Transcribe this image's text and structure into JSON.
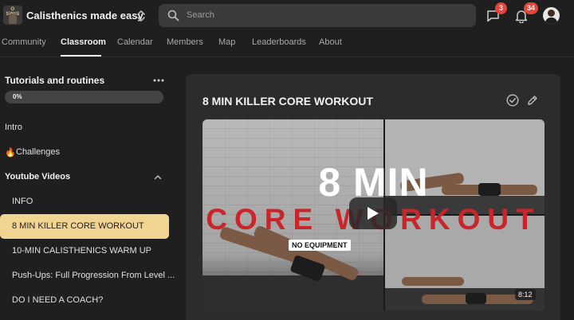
{
  "header": {
    "logo_text": "O SINIS",
    "community_name": "Calisthenics made easy",
    "search_placeholder": "Search",
    "chat_badge": "3",
    "notifications_badge": "34"
  },
  "nav": {
    "tabs": [
      {
        "label": "Community"
      },
      {
        "label": "Classroom",
        "active": true
      },
      {
        "label": "Calendar"
      },
      {
        "label": "Members"
      },
      {
        "label": "Map"
      },
      {
        "label": "Leaderboards"
      },
      {
        "label": "About"
      }
    ]
  },
  "sidebar": {
    "title": "Tutorials and routines",
    "progress_label": "0%",
    "progress_value": 0,
    "items": [
      {
        "label": "Intro"
      },
      {
        "label": "Challenges",
        "icon": "fire-icon",
        "icon_glyph": "🔥"
      },
      {
        "label": "Youtube Videos",
        "section": true
      },
      {
        "label": "INFO"
      },
      {
        "label": "8 MIN KILLER CORE WORKOUT",
        "active": true
      },
      {
        "label": "10-MIN CALISTHENICS WARM UP"
      },
      {
        "label": "Push-Ups: Full Progression From Level ..."
      },
      {
        "label": "DO I NEED A COACH?"
      }
    ]
  },
  "post": {
    "title": "8 MIN KILLER CORE WORKOUT",
    "video": {
      "headline": "8 MIN",
      "subheadline": "CORE WORKOUT",
      "tag": "NO EQUIPMENT",
      "duration": "8:12"
    }
  },
  "colors": {
    "background": "#1f1f1f",
    "panel": "#2c2c2c",
    "active_item": "#f2d492",
    "badge": "#e4453a",
    "video_red": "#c8262b"
  }
}
